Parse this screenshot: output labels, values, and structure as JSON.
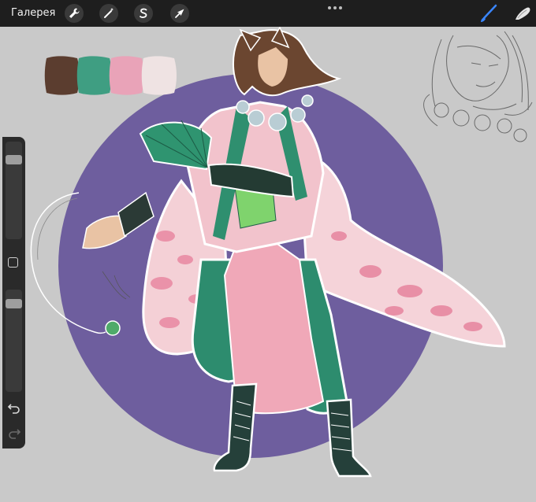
{
  "toolbar": {
    "gallery_label": "Галерея",
    "left_tools": [
      "wrench-icon",
      "magic-wand-icon",
      "selection-s-icon",
      "transform-arrow-icon"
    ],
    "right_tools": [
      "brush-icon",
      "smudge-icon"
    ],
    "active_color": "#3a86ff"
  },
  "palette": {
    "swatches": [
      "#5b3d2f",
      "#3f9e82",
      "#e9a3b8",
      "#efe3e3"
    ]
  },
  "colors": {
    "circle": "#6e5e9e",
    "robe_pink": "#f2bcc6",
    "robe_green": "#2d8c6e",
    "hair": "#6b4630",
    "background": "#c9c9c9"
  },
  "sidebar": {
    "items": [
      "brush-size-slider",
      "modify-button",
      "opacity-slider",
      "undo-icon",
      "redo-icon"
    ],
    "brush_size_level": 0.85,
    "opacity_level": 0.9
  }
}
